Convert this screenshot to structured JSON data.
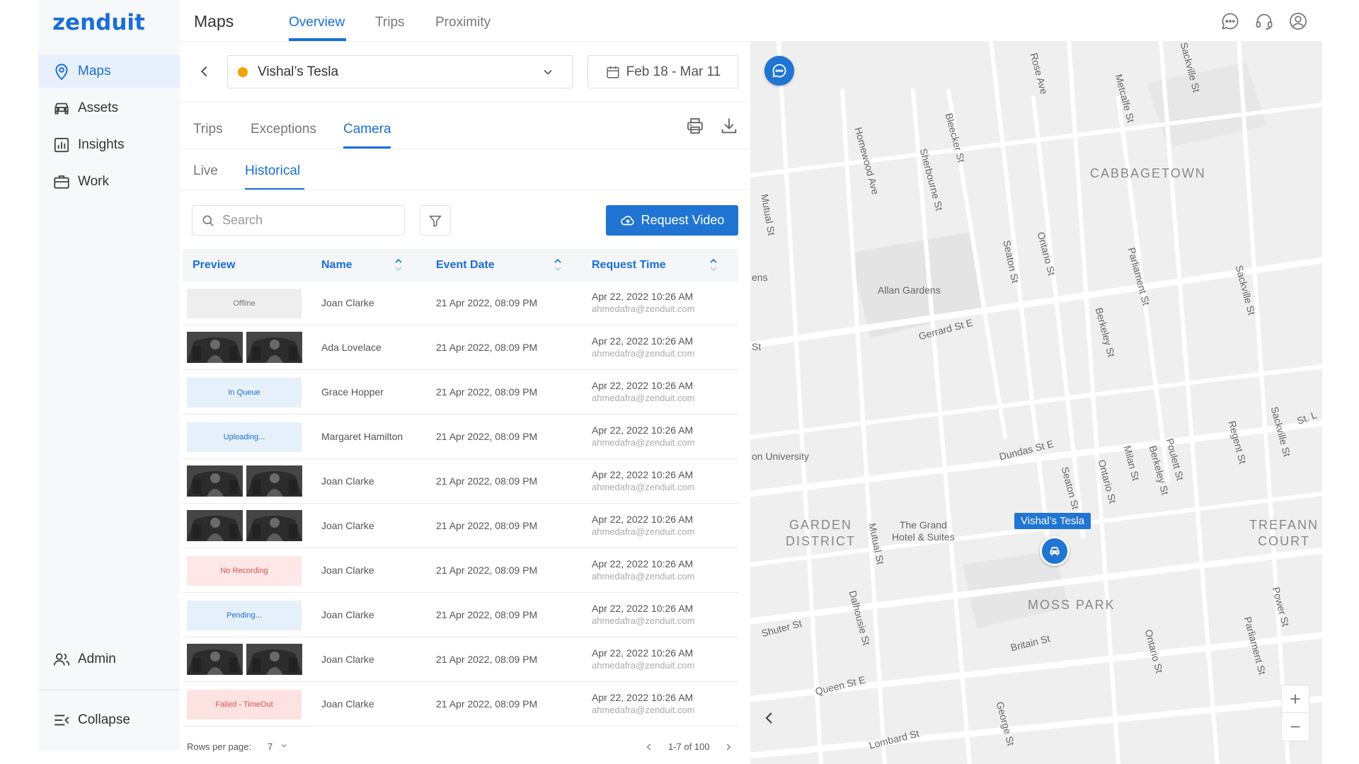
{
  "app": {
    "logo": "zenduit",
    "title": "Maps"
  },
  "top_tabs": [
    {
      "label": "Overview",
      "active": true
    },
    {
      "label": "Trips",
      "active": false
    },
    {
      "label": "Proximity",
      "active": false
    }
  ],
  "header_icons": [
    "chat-icon",
    "headset-icon",
    "account-icon"
  ],
  "sidebar": {
    "items": [
      {
        "label": "Maps",
        "icon": "map-pin-icon",
        "active": true
      },
      {
        "label": "Assets",
        "icon": "car-icon",
        "active": false
      },
      {
        "label": "Insights",
        "icon": "chart-icon",
        "active": false
      },
      {
        "label": "Work",
        "icon": "briefcase-icon",
        "active": false
      }
    ],
    "admin_label": "Admin",
    "collapse_label": "Collapse"
  },
  "vehicle_select": {
    "value": "Vishal’s Tesla",
    "status_color": "#f0a30a"
  },
  "date_range": "Feb 18 - Mar 11",
  "panel_tabs": [
    {
      "label": "Trips",
      "active": false
    },
    {
      "label": "Exceptions",
      "active": false
    },
    {
      "label": "Camera",
      "active": true
    }
  ],
  "camera_tabs": [
    {
      "label": "Live",
      "active": false
    },
    {
      "label": "Historical",
      "active": true
    }
  ],
  "search": {
    "placeholder": "Search",
    "value": ""
  },
  "request_video_label": "Request Video",
  "table": {
    "columns": [
      "Preview",
      "Name",
      "Event Date",
      "Request Time"
    ],
    "rows": [
      {
        "preview": "status",
        "status": "Offline",
        "name": "Joan Clarke",
        "event_date": "21 Apr 2022, 08:09 PM",
        "request_time": "Apr 22, 2022 10:26 AM",
        "email": "ahmedafra@zenduit.com"
      },
      {
        "preview": "thumbs",
        "status": "",
        "name": "Ada Lovelace",
        "event_date": "21 Apr 2022, 08:09 PM",
        "request_time": "Apr 22, 2022 10:26 AM",
        "email": "ahmedafra@zenduit.com"
      },
      {
        "preview": "status",
        "status": "In Queue",
        "name": "Grace Hopper",
        "event_date": "21 Apr 2022, 08:09 PM",
        "request_time": "Apr 22, 2022 10:26 AM",
        "email": "ahmedafra@zenduit.com"
      },
      {
        "preview": "status",
        "status": "Uploading...",
        "name": "Margaret Hamilton",
        "event_date": "21 Apr 2022, 08:09 PM",
        "request_time": "Apr 22, 2022 10:26 AM",
        "email": "ahmedafra@zenduit.com"
      },
      {
        "preview": "thumbs",
        "status": "",
        "name": "Joan Clarke",
        "event_date": "21 Apr 2022, 08:09 PM",
        "request_time": "Apr 22, 2022 10:26 AM",
        "email": "ahmedafra@zenduit.com"
      },
      {
        "preview": "thumbs",
        "status": "",
        "name": "Joan Clarke",
        "event_date": "21 Apr 2022, 08:09 PM",
        "request_time": "Apr 22, 2022 10:26 AM",
        "email": "ahmedafra@zenduit.com"
      },
      {
        "preview": "status",
        "status": "No Recording",
        "name": "Joan Clarke",
        "event_date": "21 Apr 2022, 08:09 PM",
        "request_time": "Apr 22, 2022 10:26 AM",
        "email": "ahmedafra@zenduit.com"
      },
      {
        "preview": "status",
        "status": "Pending...",
        "name": "Joan Clarke",
        "event_date": "21 Apr 2022, 08:09 PM",
        "request_time": "Apr 22, 2022 10:26 AM",
        "email": "ahmedafra@zenduit.com"
      },
      {
        "preview": "thumbs",
        "status": "",
        "name": "Joan Clarke",
        "event_date": "21 Apr 2022, 08:09 PM",
        "request_time": "Apr 22, 2022 10:26 AM",
        "email": "ahmedafra@zenduit.com"
      },
      {
        "preview": "status",
        "status": "Failed - TimeOut",
        "name": "Joan Clarke",
        "event_date": "21 Apr 2022, 08:09 PM",
        "request_time": "Apr 22, 2022 10:26 AM",
        "email": "ahmedafra@zenduit.com"
      }
    ]
  },
  "pagination": {
    "rows_per_page_label": "Rows per page:",
    "rows_per_page": "7",
    "range": "1-7 of 100"
  },
  "map": {
    "vehicle_label": "Vishal’s Tesla",
    "zoom_in": "+",
    "zoom_out": "−",
    "areas": [
      "CABBAGETOWN",
      "GARDEN\nDISTRICT",
      "TREFANN\nCOURT",
      "MOSS PARK"
    ],
    "places": [
      "Allan Gardens",
      "The Grand\nHotel & Suites",
      "on University",
      "ens",
      "St"
    ],
    "streets": [
      "Homewood Ave",
      "Bleecker St",
      "Sherbourne St",
      "Rose Ave",
      "Metcalfe St",
      "Sackville St",
      "Mutual St",
      "Seaton St",
      "Ontario St",
      "Parliament St",
      "Gerrard St E",
      "Berkeley St",
      "Sackville St",
      "Dundas St E",
      "Regent St",
      "Sackville St",
      "St. L",
      "Seaton St",
      "Ontario St",
      "Milan St",
      "Berkeley St",
      "Poulett St",
      "Mutual St",
      "Dalhousie St",
      "Shuter St",
      "Britain St",
      "Ontario St",
      "Power St",
      "Parliament St",
      "Queen St E",
      "George St",
      "Lombard St"
    ]
  }
}
